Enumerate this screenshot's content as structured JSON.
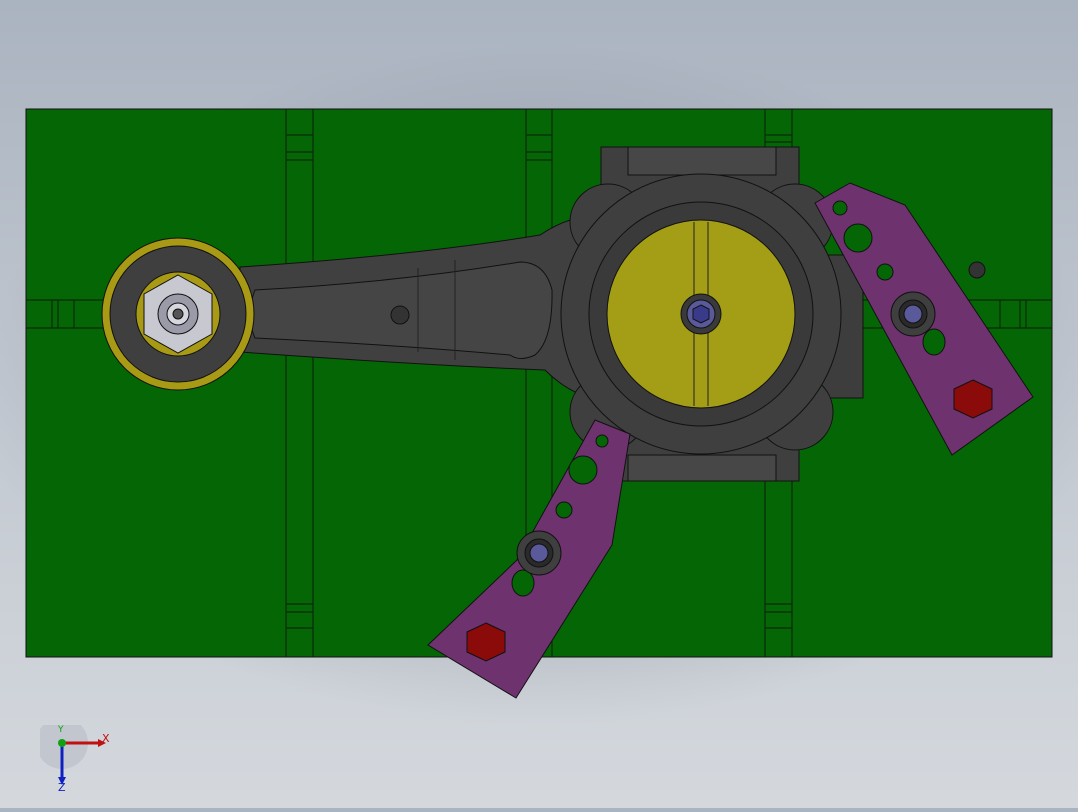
{
  "viewport": {
    "background_top": "#aab3c0",
    "background_bottom": "#d4d8dd"
  },
  "colors": {
    "base_plate": "#056605",
    "connecting_rod": "#3f3f3f",
    "bearing_ring": "#a89a14",
    "crank_disc": "#a39e15",
    "clamp": "#6e326e",
    "hex_bolt": "#8b0a0a",
    "nut": "#9a9aa8",
    "bolt_head": "#3a3a8a"
  },
  "triad": {
    "x_label": "X",
    "y_label": "Y",
    "z_label": "Z",
    "x_color": "#c01010",
    "y_color": "#10a010",
    "z_color": "#1020c0"
  }
}
